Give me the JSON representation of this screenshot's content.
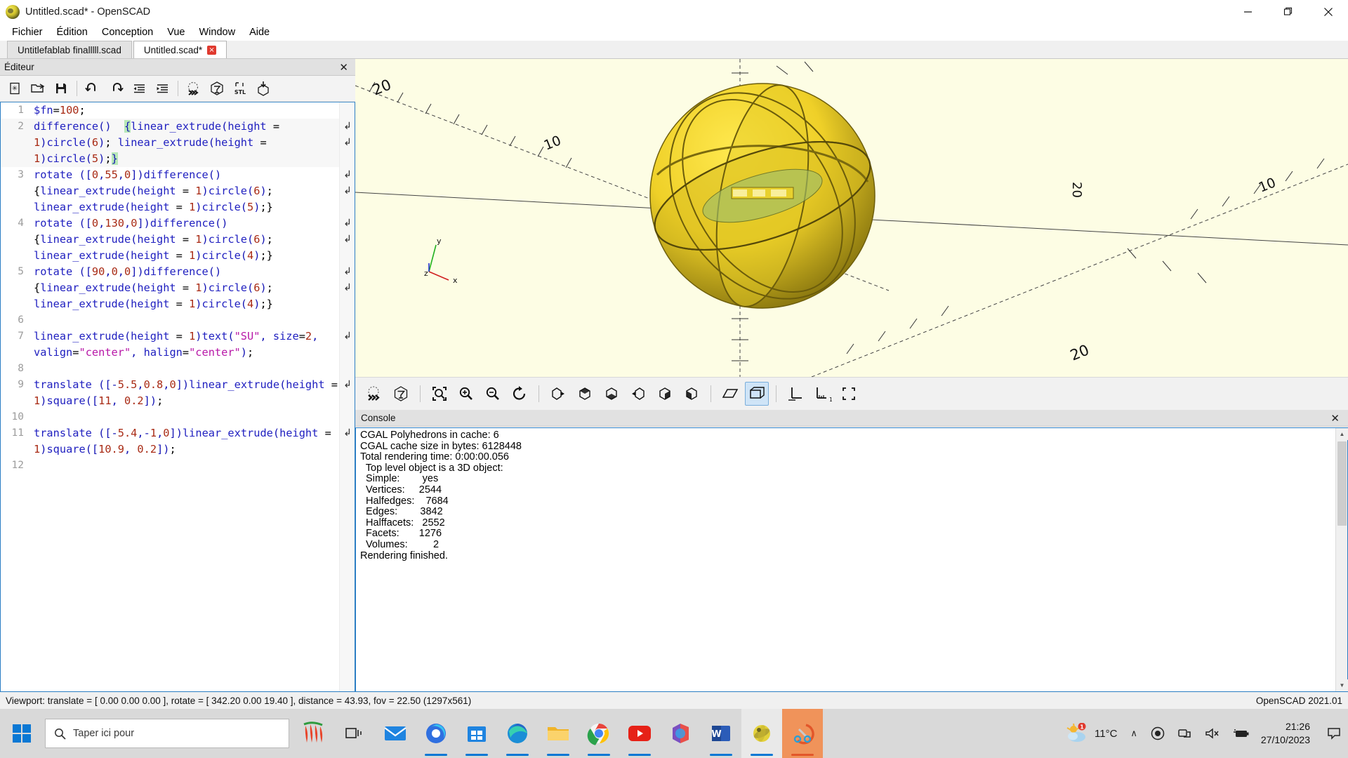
{
  "window": {
    "title": "Untitled.scad* - OpenSCAD",
    "logo_icon": "openscad-logo-icon",
    "minimize_label": "Minimize",
    "maximize_label": "Restore",
    "close_label": "Close"
  },
  "menubar": {
    "items": [
      {
        "label": "Fichier"
      },
      {
        "label": "Édition"
      },
      {
        "label": "Conception"
      },
      {
        "label": "Vue"
      },
      {
        "label": "Window"
      },
      {
        "label": "Aide"
      }
    ]
  },
  "tabs": [
    {
      "label": "Untitlefablab finalllll.scad",
      "active": false,
      "closable": false
    },
    {
      "label": "Untitled.scad*",
      "active": true,
      "closable": true,
      "close_glyph": "×"
    }
  ],
  "editor_dock": {
    "title": "Éditeur",
    "close_glyph": "✕",
    "toolbar": [
      {
        "name": "new-file-button",
        "label": "New"
      },
      {
        "name": "open-file-button",
        "label": "Open"
      },
      {
        "name": "save-file-button",
        "label": "Save"
      },
      {
        "name": "undo-button",
        "label": "Undo"
      },
      {
        "name": "redo-button",
        "label": "Redo"
      },
      {
        "name": "unindent-button",
        "label": "Unindent"
      },
      {
        "name": "indent-button",
        "label": "Indent"
      },
      {
        "name": "preview-button",
        "label": "Preview"
      },
      {
        "name": "render-button",
        "label": "Render"
      },
      {
        "name": "export-stl-button",
        "label": "Export as STL"
      },
      {
        "name": "export-mesh-button",
        "label": "Export"
      }
    ]
  },
  "code": {
    "lines": [
      {
        "n": "1",
        "highlight": false
      },
      {
        "n": "2",
        "highlight": true
      },
      {
        "n": "3",
        "highlight": false
      },
      {
        "n": "4",
        "highlight": false
      },
      {
        "n": "5",
        "highlight": false
      },
      {
        "n": "6",
        "highlight": false
      },
      {
        "n": "7",
        "highlight": false
      },
      {
        "n": "8",
        "highlight": false
      },
      {
        "n": "9",
        "highlight": false
      },
      {
        "n": "10",
        "highlight": false
      },
      {
        "n": "11",
        "highlight": false
      },
      {
        "n": "12",
        "highlight": false
      }
    ],
    "text": [
      "$fn=100;",
      "difference()  {linear_extrude(height = 1)circle(6); linear_extrude(height = 1)circle(5);}",
      "rotate ([0,55,0])difference()  {linear_extrude(height = 1)circle(6); linear_extrude(height = 1)circle(5);}",
      "rotate ([0,130,0])difference()  {linear_extrude(height = 1)circle(6); linear_extrude(height = 1)circle(4);}",
      "rotate ([90,0,0])difference()  {linear_extrude(height = 1)circle(6); linear_extrude(height = 1)circle(4);}",
      "",
      "linear_extrude(height = 1)text(\"SU\", size=2, valign=\"center\", halign=\"center\");",
      "",
      "translate ([-5.5,0.8,0])linear_extrude(height = 1)square([11, 0.2]);",
      "",
      "translate ([-5.4,-1,0])linear_extrude(height = 1)square([10.9, 0.2]);",
      ""
    ]
  },
  "viewport": {
    "axis_labels": {
      "x": "x",
      "y": "y",
      "z": "z"
    },
    "ruler_labels": [
      "20",
      "20",
      "10",
      "10",
      "20"
    ],
    "model_color": "#f2d62e",
    "background": "#fdfde4"
  },
  "viewport_toolbar": [
    {
      "name": "preview-button",
      "label": "Preview",
      "selected": false
    },
    {
      "name": "render-button",
      "label": "Render",
      "selected": false
    },
    {
      "name": "view-all-button",
      "label": "View All",
      "selected": false
    },
    {
      "name": "zoom-in-button",
      "label": "Zoom In",
      "selected": false
    },
    {
      "name": "zoom-out-button",
      "label": "Zoom Out",
      "selected": false
    },
    {
      "name": "reset-view-button",
      "label": "Reset View",
      "selected": false
    },
    {
      "name": "right-view-button",
      "label": "Right View",
      "selected": false
    },
    {
      "name": "top-view-button",
      "label": "Top View",
      "selected": false
    },
    {
      "name": "bottom-view-button",
      "label": "Bottom View",
      "selected": false
    },
    {
      "name": "left-view-button",
      "label": "Left View",
      "selected": false
    },
    {
      "name": "front-view-button",
      "label": "Front View",
      "selected": false
    },
    {
      "name": "back-view-button",
      "label": "Back View",
      "selected": false
    },
    {
      "name": "perspective-button",
      "label": "Perspective",
      "selected": false
    },
    {
      "name": "orthogonal-button",
      "label": "Orthogonal",
      "selected": true
    },
    {
      "name": "show-axes-button",
      "label": "Show Axes",
      "selected": false
    },
    {
      "name": "show-scale-markers-button",
      "label": "Show Scale Markers",
      "selected": false
    },
    {
      "name": "show-edges-button",
      "label": "Show Edges",
      "selected": false
    }
  ],
  "console": {
    "title": "Console",
    "close_glyph": "✕",
    "lines": [
      "CGAL Polyhedrons in cache: 6",
      "CGAL cache size in bytes: 6128448",
      "Total rendering time: 0:00:00.056",
      "  Top level object is a 3D object:",
      "  Simple:        yes",
      "  Vertices:     2544",
      "  Halfedges:    7684",
      "  Edges:        3842",
      "  Halffacets:   2552",
      "  Facets:       1276",
      "  Volumes:         2",
      "Rendering finished."
    ]
  },
  "statusbar": {
    "viewport_info": "Viewport: translate = [ 0.00 0.00 0.00 ], rotate = [ 342.20 0.00 19.40 ], distance = 43.93, fov = 22.50 (1297x561)",
    "version": "OpenSCAD 2021.01"
  },
  "taskbar": {
    "start_label": "Start",
    "search_placeholder": "Taper ici pour",
    "search_icon": "search-icon",
    "apps": [
      {
        "name": "taskbar-item-pepper",
        "label": "Pepper"
      },
      {
        "name": "taskbar-item-task-view",
        "label": "Task View"
      },
      {
        "name": "taskbar-item-mail",
        "label": "Mail"
      },
      {
        "name": "taskbar-item-edge-dev",
        "label": "Edge Dev"
      },
      {
        "name": "taskbar-item-store",
        "label": "Microsoft Store"
      },
      {
        "name": "taskbar-item-edge",
        "label": "Microsoft Edge"
      },
      {
        "name": "taskbar-item-explorer",
        "label": "File Explorer"
      },
      {
        "name": "taskbar-item-chrome",
        "label": "Google Chrome"
      },
      {
        "name": "taskbar-item-youtube",
        "label": "YouTube"
      },
      {
        "name": "taskbar-item-office",
        "label": "Microsoft 365"
      },
      {
        "name": "taskbar-item-word",
        "label": "Word"
      },
      {
        "name": "taskbar-item-openscad",
        "label": "OpenSCAD"
      },
      {
        "name": "taskbar-item-snip",
        "label": "Snip & Sketch"
      }
    ],
    "weather": {
      "temperature": "11°C",
      "badge": "1",
      "icon": "partly-cloudy-icon"
    },
    "tray": {
      "chevron": "∧",
      "onedrive_icon": "onedrive-icon",
      "network_icon": "network-icon",
      "volume_icon": "volume-icon",
      "battery_icon": "battery-icon"
    },
    "clock": {
      "time": "21:26",
      "date": "27/10/2023"
    },
    "notification_icon": "notification-icon"
  }
}
